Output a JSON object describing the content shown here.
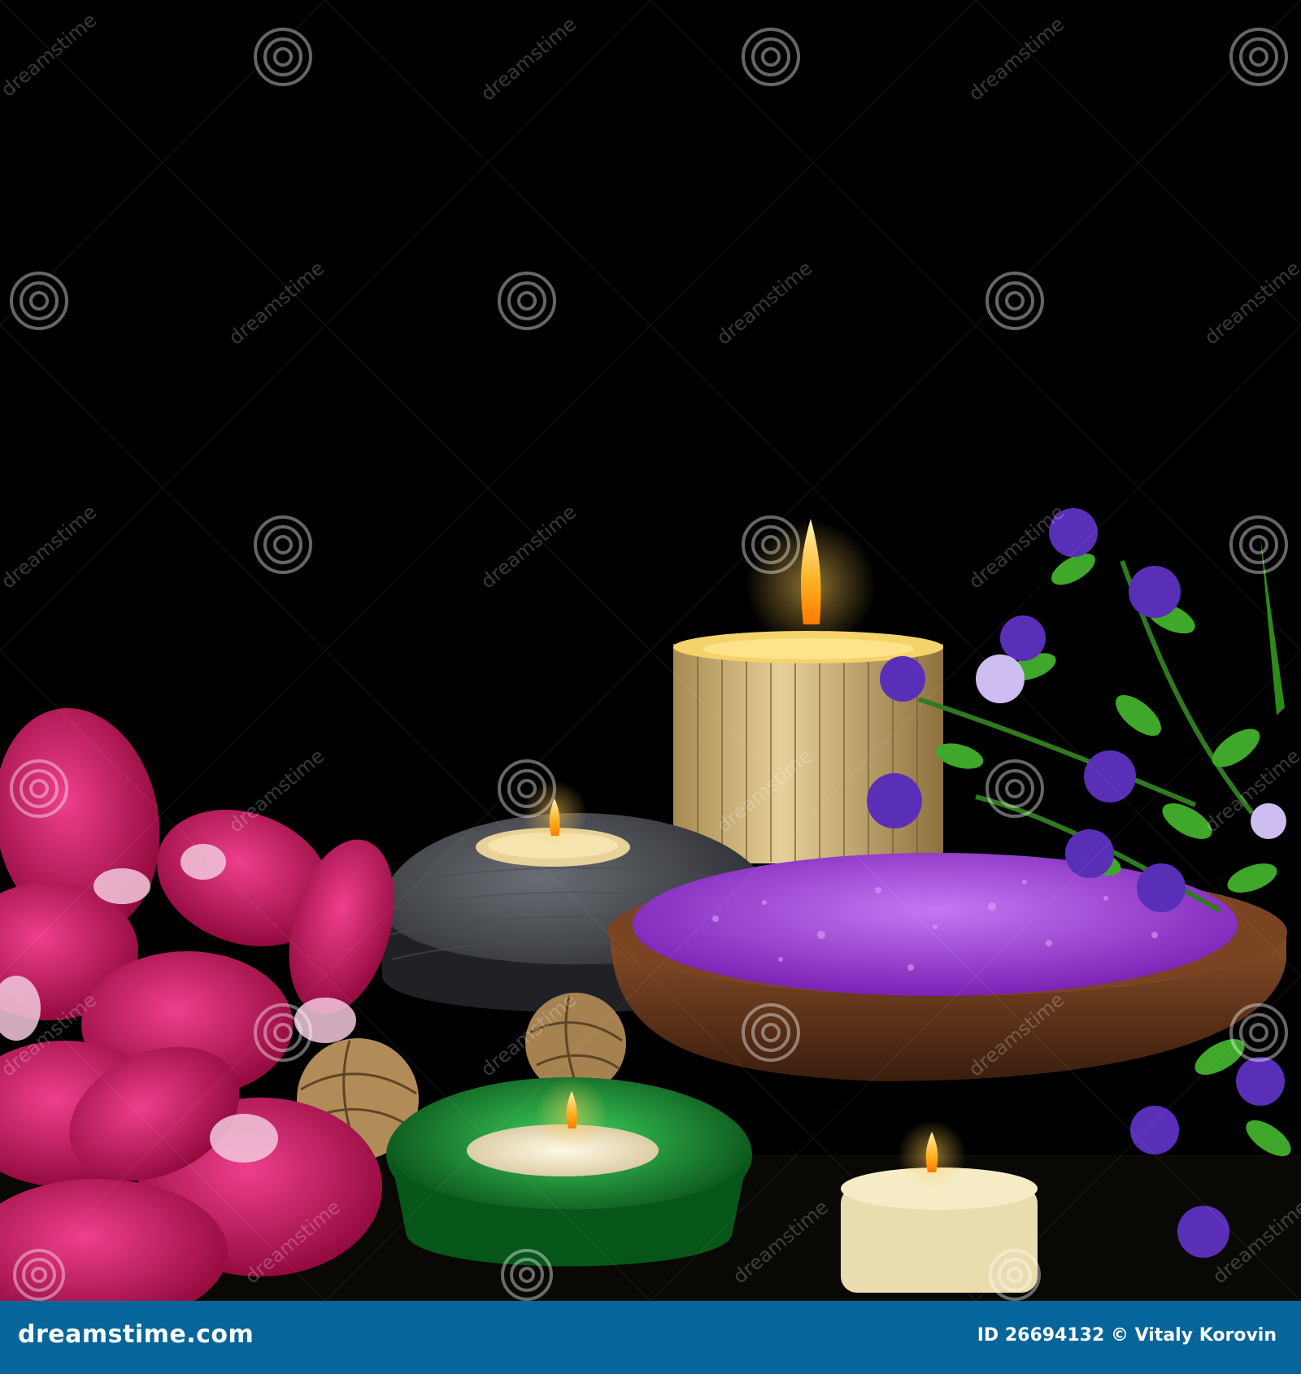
{
  "footer": {
    "logo": "dreamstime.com",
    "image_id": "ID 26694132",
    "credit": "© Vitaly Korovin"
  },
  "watermark": {
    "text": "dreamstime",
    "icon": "spiral-icon"
  },
  "colors": {
    "background": "#000000",
    "footer": "#06659a",
    "salt": "#9b3fd6",
    "orchid": "#c8125e",
    "glass": "#0f8a2a",
    "bowl": "#6b3a1f",
    "candle_bamboo": "#d9c089",
    "flame": "#ffb020"
  }
}
